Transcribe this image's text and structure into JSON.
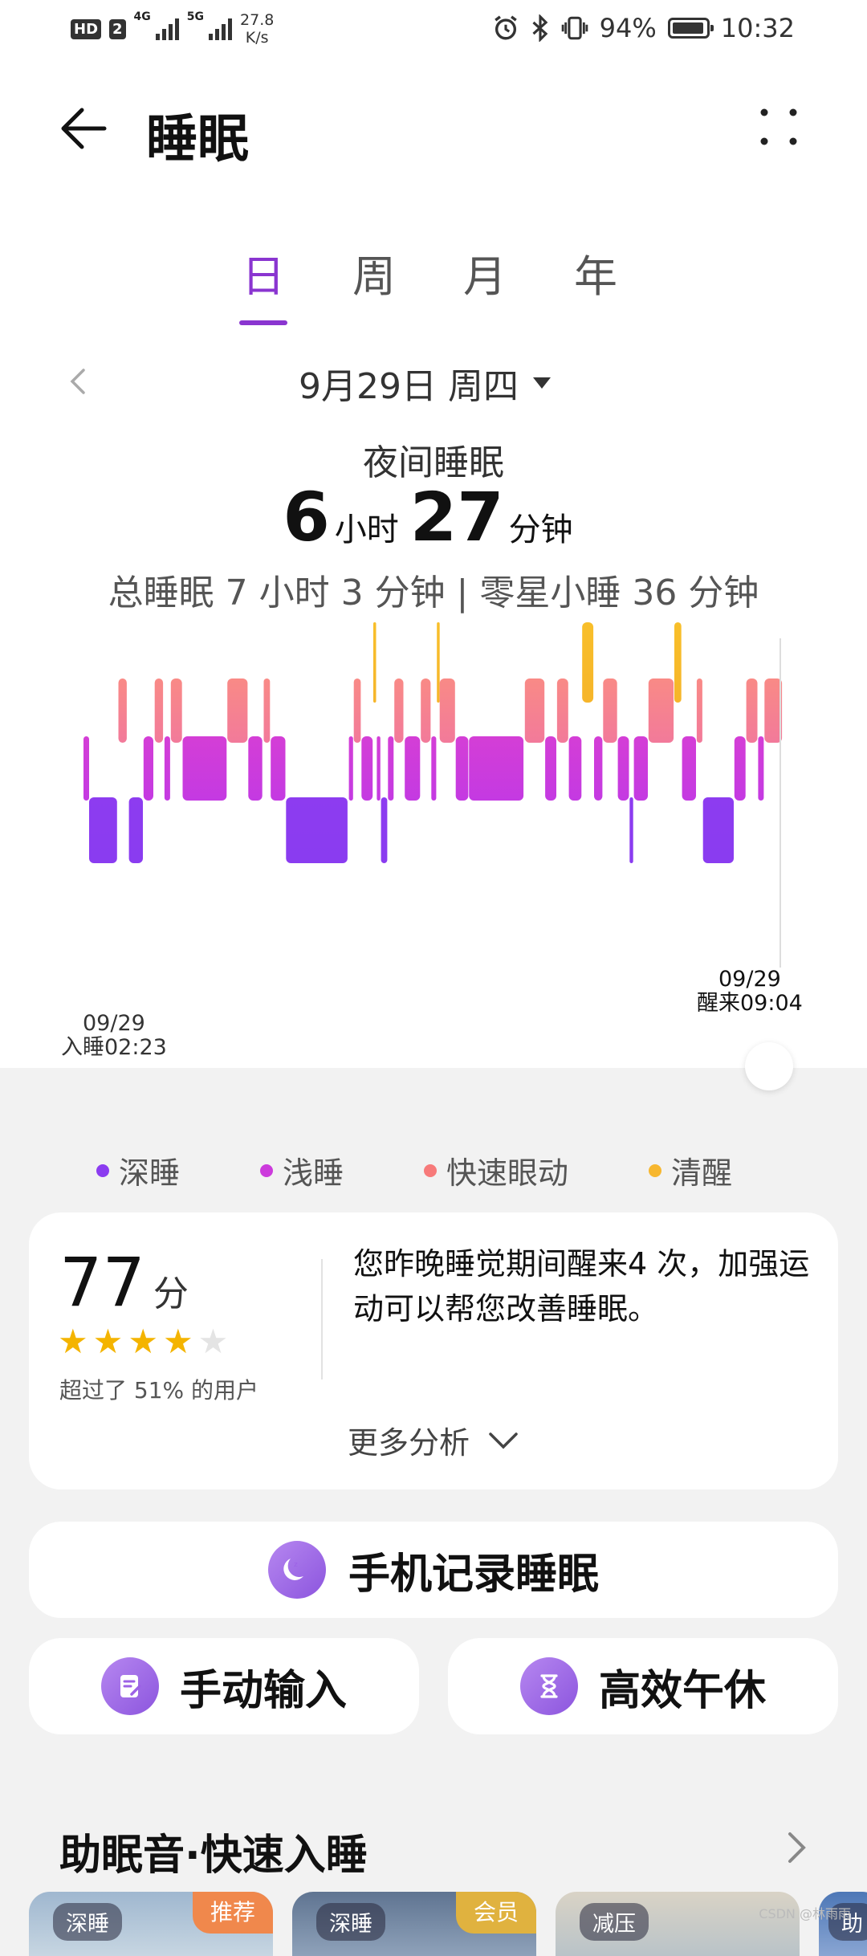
{
  "status_bar": {
    "hd": "HD",
    "sim_slot": "2",
    "sig1_label": "4G",
    "sig2_label": "5G",
    "net_speed": "27.8",
    "net_unit": "K/s",
    "battery_pct": "94%",
    "time": "10:32",
    "icons": [
      "alarm-icon",
      "bluetooth-icon",
      "vibrate-icon",
      "battery-icon"
    ]
  },
  "header": {
    "title": "睡眠",
    "back_icon": "back-arrow-icon",
    "more_icon": "more-dots-icon"
  },
  "tabs": [
    {
      "label": "日",
      "active": true
    },
    {
      "label": "周",
      "active": false
    },
    {
      "label": "月",
      "active": false
    },
    {
      "label": "年",
      "active": false
    }
  ],
  "date": {
    "label": "9月29日 周四"
  },
  "summary": {
    "night_label": "夜间睡眠",
    "hours": "6",
    "hours_unit": "小时",
    "minutes": "27",
    "minutes_unit": "分钟",
    "total_line": "总睡眠 7 小时 3 分钟 | 零星小睡 36 分钟"
  },
  "chart_data": {
    "type": "hypnogram",
    "stages": [
      "deep",
      "light",
      "rem",
      "awake"
    ],
    "colors": {
      "deep": "#8b3cf0",
      "light": "#cc3bdc",
      "rem": "#f77a7a",
      "awake": "#f7b72f"
    },
    "segments": [
      {
        "stage": "light",
        "t": 0.0,
        "d": 0.8
      },
      {
        "stage": "deep",
        "t": 0.8,
        "d": 4.0
      },
      {
        "stage": "rem",
        "t": 5.0,
        "d": 1.2
      },
      {
        "stage": "deep",
        "t": 6.5,
        "d": 2.0
      },
      {
        "stage": "light",
        "t": 8.6,
        "d": 1.4
      },
      {
        "stage": "rem",
        "t": 10.2,
        "d": 1.2
      },
      {
        "stage": "light",
        "t": 11.6,
        "d": 0.8
      },
      {
        "stage": "rem",
        "t": 12.5,
        "d": 1.6
      },
      {
        "stage": "light",
        "t": 14.2,
        "d": 6.3
      },
      {
        "stage": "rem",
        "t": 20.6,
        "d": 2.9
      },
      {
        "stage": "light",
        "t": 23.6,
        "d": 2.0
      },
      {
        "stage": "rem",
        "t": 25.8,
        "d": 0.9
      },
      {
        "stage": "light",
        "t": 26.8,
        "d": 2.1
      },
      {
        "stage": "deep",
        "t": 29.0,
        "d": 8.8
      },
      {
        "stage": "light",
        "t": 38.0,
        "d": 0.6
      },
      {
        "stage": "rem",
        "t": 38.7,
        "d": 1.0
      },
      {
        "stage": "light",
        "t": 39.8,
        "d": 1.6
      },
      {
        "stage": "awake",
        "t": 41.5,
        "d": 0.4
      },
      {
        "stage": "light",
        "t": 42.0,
        "d": 0.5
      },
      {
        "stage": "deep",
        "t": 42.6,
        "d": 0.9
      },
      {
        "stage": "light",
        "t": 43.6,
        "d": 0.8
      },
      {
        "stage": "rem",
        "t": 44.5,
        "d": 1.3
      },
      {
        "stage": "light",
        "t": 46.0,
        "d": 2.2
      },
      {
        "stage": "rem",
        "t": 48.3,
        "d": 1.4
      },
      {
        "stage": "light",
        "t": 49.8,
        "d": 0.7
      },
      {
        "stage": "awake",
        "t": 50.6,
        "d": 0.4
      },
      {
        "stage": "rem",
        "t": 51.0,
        "d": 2.2
      },
      {
        "stage": "light",
        "t": 53.3,
        "d": 1.8
      },
      {
        "stage": "light",
        "t": 55.2,
        "d": 7.8
      },
      {
        "stage": "rem",
        "t": 63.2,
        "d": 2.8
      },
      {
        "stage": "light",
        "t": 66.1,
        "d": 1.6
      },
      {
        "stage": "rem",
        "t": 67.8,
        "d": 1.6
      },
      {
        "stage": "light",
        "t": 69.5,
        "d": 1.8
      },
      {
        "stage": "awake",
        "t": 71.4,
        "d": 1.6
      },
      {
        "stage": "light",
        "t": 73.1,
        "d": 1.2
      },
      {
        "stage": "rem",
        "t": 74.4,
        "d": 2.0
      },
      {
        "stage": "light",
        "t": 76.5,
        "d": 1.6
      },
      {
        "stage": "deep",
        "t": 78.2,
        "d": 0.5
      },
      {
        "stage": "light",
        "t": 78.8,
        "d": 2.0
      },
      {
        "stage": "rem",
        "t": 80.9,
        "d": 3.6
      },
      {
        "stage": "awake",
        "t": 84.6,
        "d": 1.0
      },
      {
        "stage": "light",
        "t": 85.7,
        "d": 2.0
      },
      {
        "stage": "rem",
        "t": 87.8,
        "d": 0.8
      },
      {
        "stage": "deep",
        "t": 88.7,
        "d": 4.4
      },
      {
        "stage": "light",
        "t": 93.2,
        "d": 1.6
      },
      {
        "stage": "rem",
        "t": 94.9,
        "d": 1.6
      },
      {
        "stage": "light",
        "t": 96.6,
        "d": 0.8
      },
      {
        "stage": "rem",
        "t": 97.5,
        "d": 2.5
      }
    ],
    "bedtime_date": "09/29",
    "bedtime_label": "入睡02:23",
    "wake_date": "09/29",
    "wake_label": "醒来09:04"
  },
  "legend": [
    {
      "label": "深睡",
      "color": "#8b3cf0"
    },
    {
      "label": "浅睡",
      "color": "#cc3bdc"
    },
    {
      "label": "快速眼动",
      "color": "#f77a7a"
    },
    {
      "label": "清醒",
      "color": "#f7b72f"
    }
  ],
  "score_card": {
    "score": "77",
    "score_unit": "分",
    "stars": 4,
    "stars_max": 5,
    "percentile_text": "超过了 51% 的用户",
    "advice": "您昨晚睡觉期间醒来4 次，加强运动可以帮您改善睡眠。",
    "more_label": "更多分析"
  },
  "actions": {
    "phone_record": "手机记录睡眠",
    "manual_input": "手动输入",
    "nap": "高效午休"
  },
  "sleep_sounds": {
    "title": "助眠音·快速入睡",
    "tiles": [
      {
        "tag": "深睡",
        "badge": "推荐",
        "badge_color": "#f0884c"
      },
      {
        "tag": "深睡",
        "badge": "会员",
        "badge_color": "#e0b23f"
      },
      {
        "tag": "减压",
        "badge": "",
        "badge_color": ""
      },
      {
        "tag": "助",
        "badge": "",
        "badge_color": ""
      }
    ]
  },
  "watermark": "CSDN @林雨雨"
}
